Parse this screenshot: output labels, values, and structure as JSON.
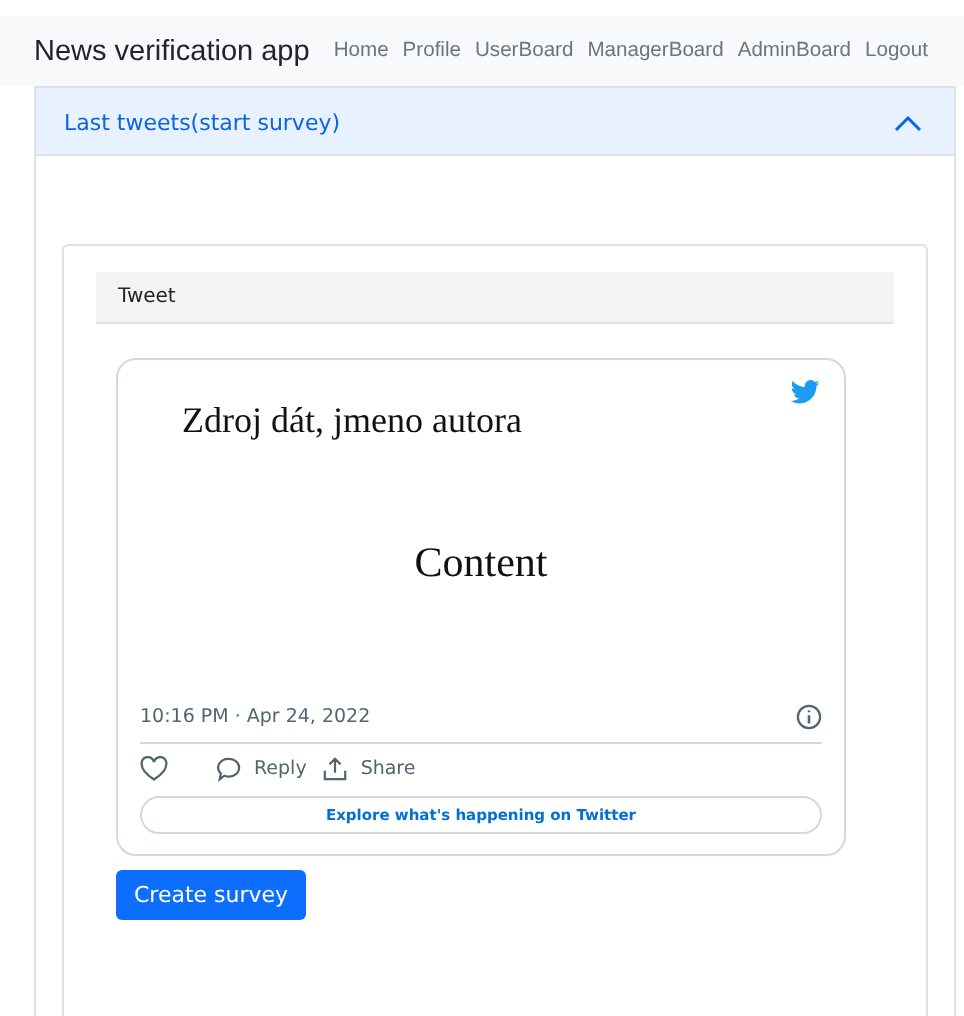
{
  "navbar": {
    "brand": "News verification app",
    "links": [
      "Home",
      "Profile",
      "UserBoard",
      "ManagerBoard",
      "AdminBoard",
      "Logout"
    ]
  },
  "accordion": {
    "title": "Last tweets(start survey)",
    "expanded": true
  },
  "card": {
    "header": "Tweet"
  },
  "tweet": {
    "source": "Zdroj dát, jmeno autora",
    "content": "Content",
    "time": "10:16 PM · Apr 24, 2022",
    "reply": "Reply",
    "share": "Share",
    "explore": "Explore what's happening on Twitter"
  },
  "button": "Create survey"
}
